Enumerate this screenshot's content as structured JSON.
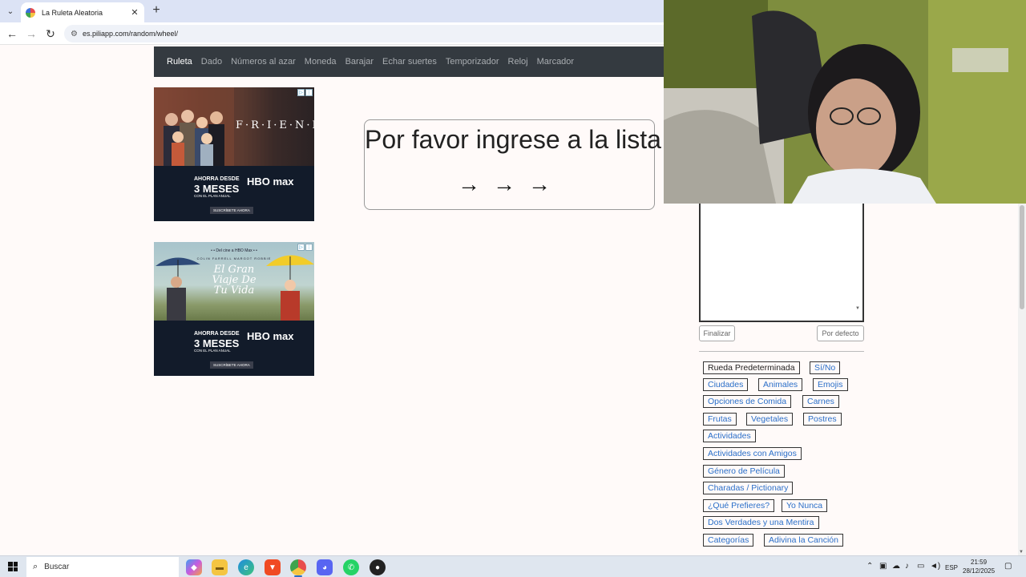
{
  "browser": {
    "tab_title": "La Ruleta Aleatoria",
    "url": "es.piliapp.com/random/wheel/"
  },
  "sitenav": {
    "items": [
      {
        "label": "Ruleta"
      },
      {
        "label": "Dado"
      },
      {
        "label": "Números al azar"
      },
      {
        "label": "Moneda"
      },
      {
        "label": "Barajar"
      },
      {
        "label": "Echar suertes"
      },
      {
        "label": "Temporizador"
      },
      {
        "label": "Reloj"
      },
      {
        "label": "Marcador"
      }
    ]
  },
  "ads": {
    "friends": {
      "logo": "F·R·I·E·N·D·S",
      "ahorra": "AHORRA DESDE",
      "meses": "3 MESES",
      "plan": "CON EL PLAN ANUAL",
      "brand": "HBO max",
      "cta": "SUSCRÍBETE AHORA"
    },
    "movie": {
      "tagline": "• • Del cine a HBO Max • •",
      "actors": "COLIN FARRELL    MARGOT ROBBIE",
      "title": "El Gran Viaje De Tu Vida",
      "ahorra": "AHORRA DESDE",
      "meses": "3 MESES",
      "plan": "CON EL PLAN ANUAL",
      "brand": "HBO max",
      "cta": "SUSCRÍBETE AHORA"
    }
  },
  "prompt": {
    "message": "Por favor ingrese a la lista",
    "arrows": "→→→"
  },
  "editor": {
    "finalize_label": "Finalizar",
    "default_label": "Por defecto"
  },
  "presets": [
    "Rueda Predeterminada",
    "Sí/No",
    "Ciudades",
    "Animales",
    "Emojis",
    "Opciones de Comida",
    "Carnes",
    "Frutas",
    "Vegetales",
    "Postres",
    "Actividades",
    "Actividades con Amigos",
    "Género de Película",
    "Charadas / Pictionary",
    "¿Qué Prefieres?",
    "Yo Nunca",
    "Dos Verdades y una Mentira",
    "Categorías",
    "Adivina la Canción"
  ],
  "taskbar": {
    "search_label": "Buscar",
    "language": "ESP",
    "time": "21:59",
    "date": "28/12/2025"
  }
}
